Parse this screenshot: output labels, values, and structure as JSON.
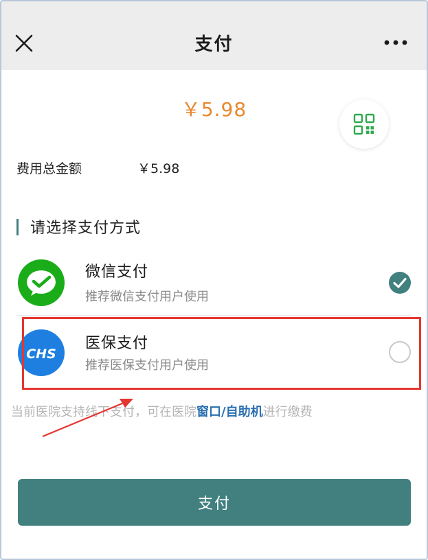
{
  "header": {
    "title": "支付",
    "close_icon": "close-icon",
    "more_icon": "more-horizontal-icon"
  },
  "amount": {
    "display": "￥5.98",
    "color": "#e9872e"
  },
  "summary": {
    "total_label": "费用总金额",
    "total_value": "￥5.98"
  },
  "qr_icon": "qr-code-icon",
  "payment_section": {
    "title": "请选择支付方式",
    "options": [
      {
        "title": "微信支付",
        "subtitle": "推荐微信支付用户使用",
        "icon": "wechat-pay-icon",
        "selected": true
      },
      {
        "title": "医保支付",
        "subtitle": "推荐医保支付用户使用",
        "icon": "chs-medical-insurance-icon",
        "icon_text": "CHS",
        "selected": false
      }
    ]
  },
  "notice": {
    "prefix": "当前医院支持线下支付，可在医院",
    "link": "窗口/自助机",
    "suffix": "进行缴费"
  },
  "pay_button": {
    "label": "支付"
  },
  "colors": {
    "accent": "#41807f",
    "amount": "#e9872e",
    "link": "#2a6fb0",
    "annotation": "#e53631",
    "wechat_green": "#1aad19",
    "chs_blue": "#1e7fe0"
  }
}
